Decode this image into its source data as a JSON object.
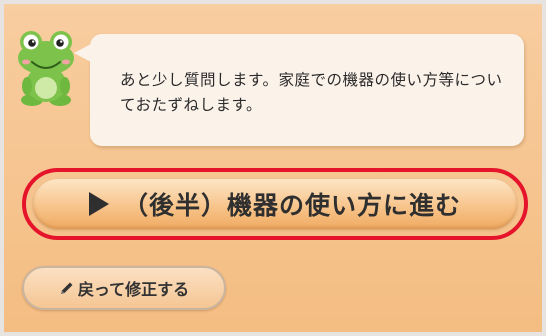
{
  "chat": {
    "message": "あと少し質問します。家庭での機器の使い方等についておたずねします。"
  },
  "mascot": {
    "icon": "frog-icon"
  },
  "actions": {
    "proceed_label": "（後半）機器の使い方に進む",
    "proceed_icon": "play-icon",
    "back_label": "戻って修正する",
    "back_icon": "pencil-icon"
  },
  "colors": {
    "background": "#f6c28a",
    "bubble": "#fbf2ea",
    "highlight_outline": "#e5142b",
    "button_fill": "#f7c48b",
    "text": "#2f2f2f"
  }
}
